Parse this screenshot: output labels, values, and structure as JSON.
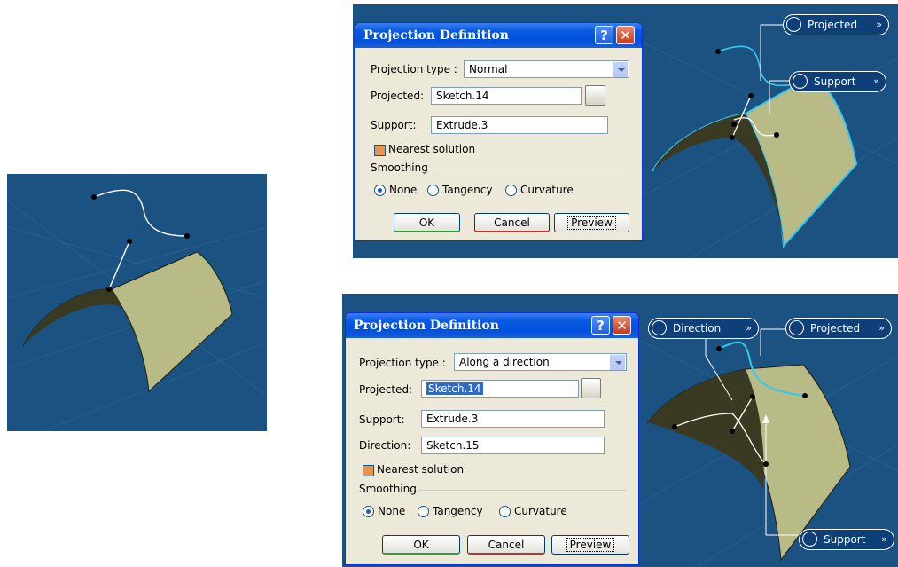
{
  "dialog1": {
    "title": "Projection Definition",
    "help_label": "?",
    "close_label": "✕",
    "projection_type_label": "Projection type :",
    "projection_type_value": "Normal",
    "projected_label": "Projected:",
    "projected_value": "Sketch.14",
    "support_label": "Support:",
    "support_value": "Extrude.3",
    "nearest_solution_label": "Nearest solution",
    "smoothing_label": "Smoothing",
    "smoothing_options": [
      "None",
      "Tangency",
      "Curvature"
    ],
    "ok_label": "OK",
    "cancel_label": "Cancel",
    "preview_label": "Preview"
  },
  "dialog2": {
    "title": "Projection Definition",
    "help_label": "?",
    "close_label": "✕",
    "projection_type_label": "Projection type :",
    "projection_type_value": "Along a direction",
    "projected_label": "Projected:",
    "projected_value": "Sketch.14",
    "support_label": "Support:",
    "support_value": "Extrude.3",
    "direction_label": "Direction:",
    "direction_value": "Sketch.15",
    "nearest_solution_label": "Nearest solution",
    "smoothing_label": "Smoothing",
    "smoothing_options": [
      "None",
      "Tangency",
      "Curvature"
    ],
    "ok_label": "OK",
    "cancel_label": "Cancel",
    "preview_label": "Preview"
  },
  "viewport1_tags": {
    "projected": "Projected",
    "support": "Support",
    "chevron": "»"
  },
  "viewport2_tags": {
    "direction": "Direction",
    "projected": "Projected",
    "support": "Support",
    "chevron": "»"
  },
  "colors": {
    "viewport_bg": "#1a4f80",
    "surface": "#c4c596",
    "highlight": "#37c8ee",
    "titlebar": "#0a5be1"
  },
  "icons": [
    "checkbox-checked",
    "radio-selected",
    "radio-unselected",
    "dropdown-arrow",
    "selection-picker-icon",
    "curve-icon",
    "surface-icon"
  ]
}
